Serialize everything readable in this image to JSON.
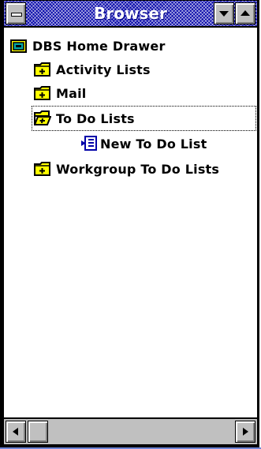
{
  "window": {
    "title": "Browser"
  },
  "tree": {
    "root": {
      "label": "DBS Home Drawer",
      "icon": "drawer-icon"
    },
    "items": [
      {
        "label": "Activity Lists",
        "icon": "folder-closed-icon"
      },
      {
        "label": "Mail",
        "icon": "folder-closed-icon"
      },
      {
        "label": "To Do Lists",
        "icon": "folder-open-icon",
        "selected": true
      },
      {
        "label": "New To Do List",
        "icon": "todo-list-icon"
      },
      {
        "label": "Workgroup To Do Lists",
        "icon": "folder-closed-icon"
      }
    ]
  },
  "colors": {
    "titlebar": "#0000a8",
    "folder": "#ffff00",
    "chrome": "#c0c0c0"
  }
}
